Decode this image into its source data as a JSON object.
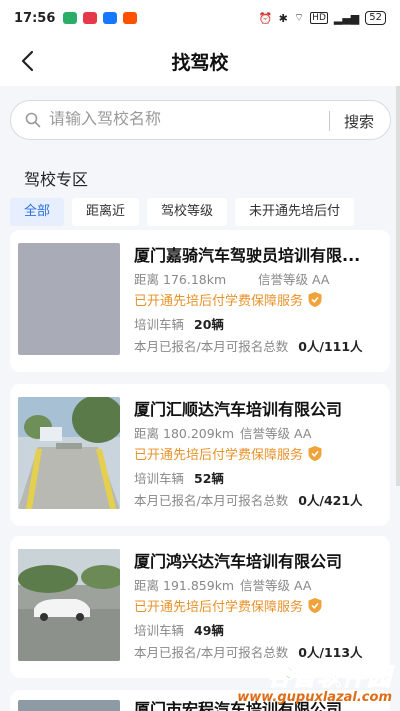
{
  "status_bar": {
    "time": "17:56",
    "battery": "52",
    "signal_label": "HD",
    "left_icons": [
      "wechat-icon",
      "app-icon",
      "alipay-icon",
      "taobao-icon"
    ],
    "left_icon_colors": [
      "#2aae67",
      "#e5394a",
      "#1677ff",
      "#ff5000"
    ]
  },
  "nav": {
    "title": "找驾校"
  },
  "search": {
    "placeholder": "请输入驾校名称",
    "button_label": "搜索"
  },
  "section": {
    "title": "驾校专区"
  },
  "filters": [
    {
      "label": "全部",
      "active": true
    },
    {
      "label": "距离近",
      "active": false
    },
    {
      "label": "驾校等级",
      "active": false
    },
    {
      "label": "未开通先培后付",
      "active": false
    }
  ],
  "schools": [
    {
      "name": "厦门嘉骑汽车驾驶员培训有限...",
      "distance_label": "距离",
      "distance": "176.18km",
      "credit_label": "信誉等级",
      "credit": "AA",
      "service": "已开通先培后付学费保障服务",
      "vehicles_label": "培训车辆",
      "vehicles": "20辆",
      "enroll_label": "本月已报名/本月可报名总数",
      "enroll": "0人/111人"
    },
    {
      "name": "厦门汇顺达汽车培训有限公司",
      "distance_label": "距离",
      "distance": "180.209km",
      "credit_label": "信誉等级",
      "credit": "AA",
      "service": "已开通先培后付学费保障服务",
      "vehicles_label": "培训车辆",
      "vehicles": "52辆",
      "enroll_label": "本月已报名/本月可报名总数",
      "enroll": "0人/421人"
    },
    {
      "name": "厦门鸿兴达汽车培训有限公司",
      "distance_label": "距离",
      "distance": "191.859km",
      "credit_label": "信誉等级",
      "credit": "AA",
      "service": "已开通先培后付学费保障服务",
      "vehicles_label": "培训车辆",
      "vehicles": "49辆",
      "enroll_label": "本月已报名/本月可报名总数",
      "enroll": "0人/113人"
    },
    {
      "name": "厦门市宏程汽车培训有限公司"
    }
  ],
  "watermark": {
    "title": "谷普软件园",
    "url": "www.gupuxlazal.com"
  },
  "colors": {
    "accent": "#2e6fe0",
    "service_orange": "#e8922a",
    "page_bg": "#f4f6f9"
  }
}
